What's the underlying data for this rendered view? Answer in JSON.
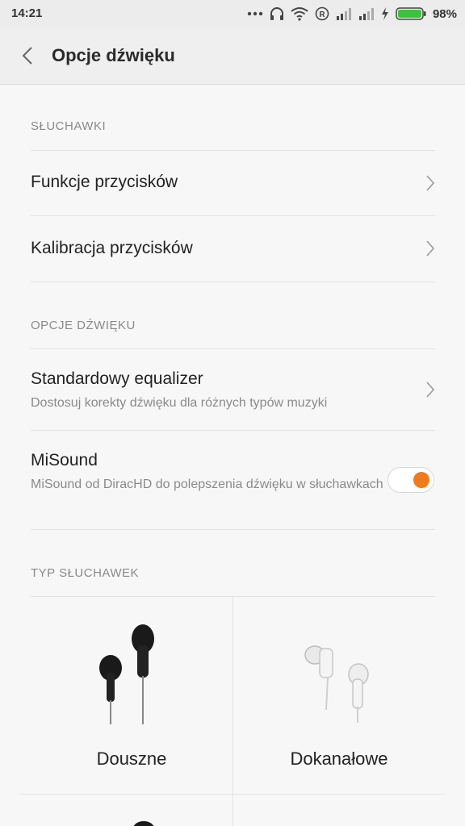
{
  "status_bar": {
    "time": "14:21",
    "battery_percent": "98%",
    "icons": [
      "dots-icon",
      "headphones-icon",
      "wifi-icon",
      "registered-icon",
      "signal-icon",
      "signal-icon",
      "charging-icon",
      "battery-icon"
    ],
    "battery_color": "#3cc33c"
  },
  "header": {
    "title": "Opcje dźwięku",
    "back_icon": "chevron-left-icon"
  },
  "sections": {
    "headphones": {
      "header": "SŁUCHAWKI",
      "items": [
        {
          "title": "Funkcje przycisków"
        },
        {
          "title": "Kalibracja przycisków"
        }
      ]
    },
    "sound_options": {
      "header": "OPCJE DŹWIĘKU",
      "equalizer": {
        "title": "Standardowy equalizer",
        "subtitle": "Dostosuj korekty dźwięku dla różnych typów muzyki"
      },
      "misound": {
        "title": "MiSound",
        "subtitle": "MiSound od DiracHD do polepszenia dźwięku w słuchawkach",
        "enabled": true,
        "accent_color": "#f07b1a"
      }
    },
    "headphone_type": {
      "header": "TYP SŁUCHAWEK",
      "options": [
        {
          "label": "Douszne",
          "icon": "earbuds-black-icon"
        },
        {
          "label": "Dokanałowe",
          "icon": "in-ear-white-icon"
        }
      ]
    }
  }
}
